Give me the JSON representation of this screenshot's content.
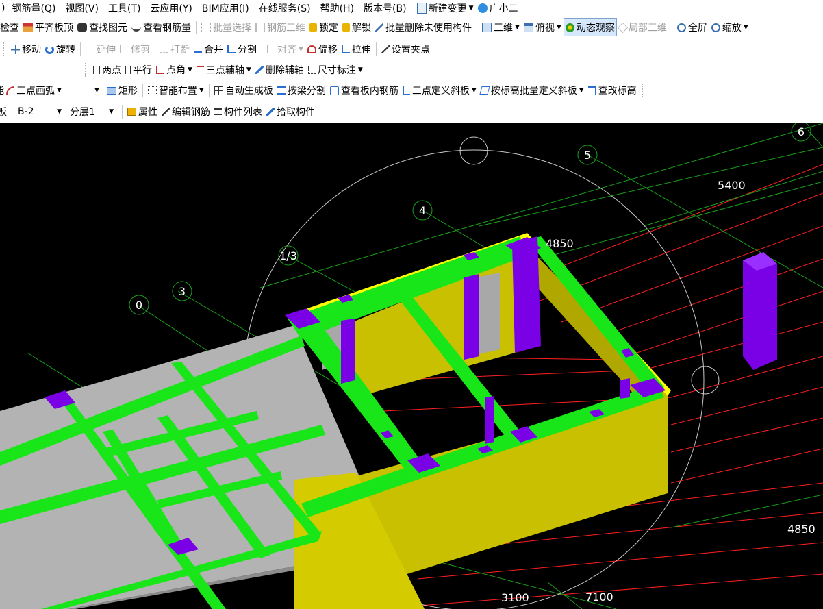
{
  "menubar": {
    "items": [
      "钢筋量(Q)",
      "视图(V)",
      "工具(T)",
      "云应用(Y)",
      "BIM应用(I)",
      "在线服务(S)",
      "帮助(H)",
      "版本号(B)",
      "新建变更",
      "广小二"
    ],
    "lead": ")"
  },
  "toolbar1": {
    "check": "检查",
    "flush_top": "平齐板顶",
    "find_element": "查找图元",
    "view_rebar": "查看钢筋量",
    "batch_select": "批量选择",
    "rebar_3d": "钢筋三维",
    "lock": "锁定",
    "unlock": "解锁",
    "batch_delete_unused": "批量删除未使用构件",
    "three_d": "三维",
    "top_view": "俯视",
    "dynamic_view": "动态观察",
    "local_3d": "局部三维",
    "full_screen": "全屏",
    "zoom": "缩放"
  },
  "toolbar2": {
    "move": "移动",
    "rotate": "旋转",
    "extend": "延伸",
    "trim": "修剪",
    "break": "打断",
    "merge": "合并",
    "split": "分割",
    "align": "对齐",
    "offset": "偏移",
    "stretch": "拉伸",
    "set_grip": "设置夹点"
  },
  "toolbar3": {
    "two_points": "两点",
    "parallel": "平行",
    "point_angle": "点角",
    "three_point_axis": "三点辅轴",
    "delete_axis": "删除辅轴",
    "dimension": "尺寸标注"
  },
  "toolbar4": {
    "arc_three_point": "三点画弧",
    "arc_lead": "能",
    "combo_value": "",
    "rectangle": "矩形",
    "smart_layout": "智能布置",
    "auto_slab": "自动生成板",
    "split_by_beam": "按梁分割",
    "view_slab_rebar": "查看板内钢筋",
    "three_point_slope": "三点定义斜板",
    "batch_slope_by_elev": "按标高批量定义斜板",
    "check_elevation": "查改标高"
  },
  "toolbar5": {
    "type_lead": "板",
    "component": "B-2",
    "layer": "分层1",
    "properties": "属性",
    "edit_rebar": "编辑钢筋",
    "component_list": "构件列表",
    "pick_component": "拾取构件"
  },
  "viewport": {
    "axis_labels": [
      "0",
      "3",
      "1/3",
      "4",
      "5",
      "6"
    ],
    "dimensions": [
      "5400",
      "4850",
      "4850",
      "3100",
      "7100"
    ],
    "colors": {
      "background": "#000000",
      "beam": "#19e619",
      "slab": "#b3b3b3",
      "wall": "#c8c000",
      "wall_edge": "#ffff00",
      "column": "#7a00e6",
      "grid_red": "#ff2020",
      "grid_green": "#1aa01a",
      "orbit_circle": "#c8c8c8"
    }
  }
}
